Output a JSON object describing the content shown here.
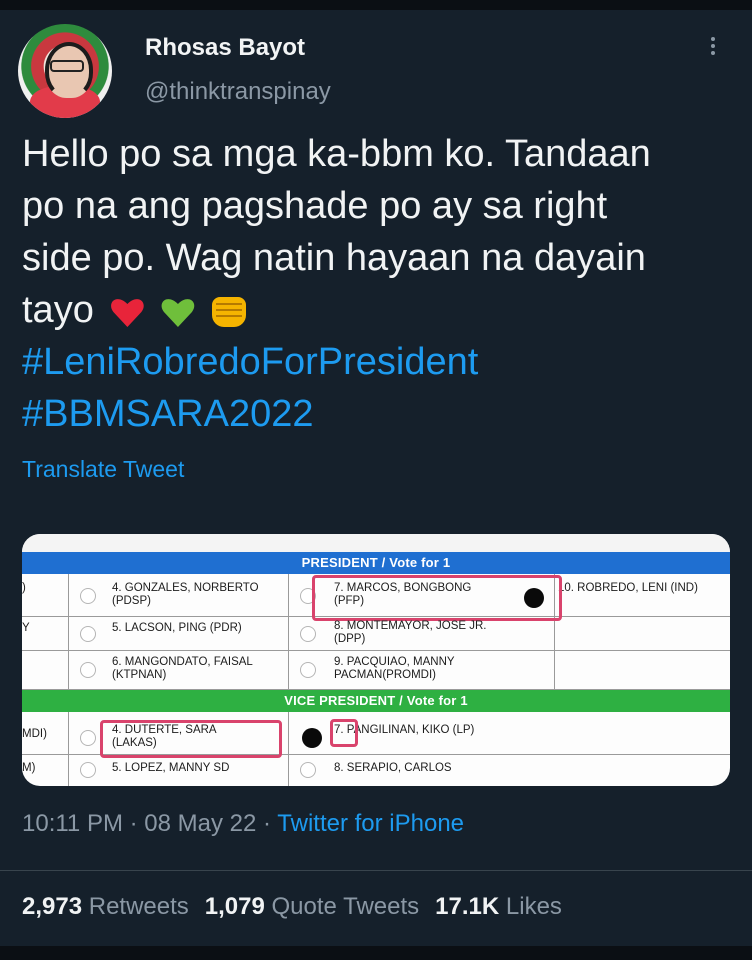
{
  "author": {
    "name": "Rhosas Bayot",
    "handle": "@thinktranspinay"
  },
  "tweet": {
    "line1": "Hello po sa mga ka-bbm ko. Tandaan",
    "line2": "po na ang pagshade po ay sa right",
    "line3": "side po. Wag natin hayaan na dayain",
    "line4": "tayo",
    "emojis": [
      "red-heart-icon",
      "green-heart-icon",
      "fist-icon"
    ],
    "hashtag1": "#LeniRobredoForPresident",
    "hashtag2": "#BBMSARA2022"
  },
  "translate_label": "Translate Tweet",
  "ballot": {
    "president_header": "PRESIDENT / Vote for 1",
    "vp_header": "VICE PRESIDENT / Vote for 1",
    "president_rows": [
      {
        "left_edge": ")",
        "c1": "4. GONZALES, NORBERTO (PDSP)",
        "c2": "7. MARCOS, BONGBONG (PFP)",
        "c3": "10. ROBREDO, LENI (IND)"
      },
      {
        "left_edge": "Y",
        "c1": "5. LACSON, PING (PDR)",
        "c2": "8. MONTEMAYOR, JOSE JR. (DPP)",
        "c3": ""
      },
      {
        "left_edge": "",
        "c1": "6. MANGONDATO, FAISAL (KTPNAN)",
        "c2": "9. PACQUIAO, MANNY PACMAN(PROMDI)",
        "c3": ""
      }
    ],
    "vp_rows": [
      {
        "left_edge": "MDI)",
        "c1": "4. DUTERTE, SARA (LAKAS)",
        "c2": "7. PANGILINAN, KIKO (LP)"
      },
      {
        "left_edge": "M)",
        "c1": "5. LOPEZ, MANNY SD",
        "c2": "8. SERAPIO, CARLOS"
      }
    ],
    "colors": {
      "blue_band": "#1f6fd1",
      "green_band": "#2eb042",
      "highlight": "#d9436c"
    }
  },
  "meta": {
    "time": "10:11 PM",
    "separator": "·",
    "date": "08 May 22",
    "client": "Twitter for iPhone"
  },
  "stats": {
    "retweets_count": "2,973",
    "retweets_label": "Retweets",
    "quotes_count": "1,079",
    "quotes_label": "Quote Tweets",
    "likes_count": "17.1K",
    "likes_label": "Likes"
  }
}
